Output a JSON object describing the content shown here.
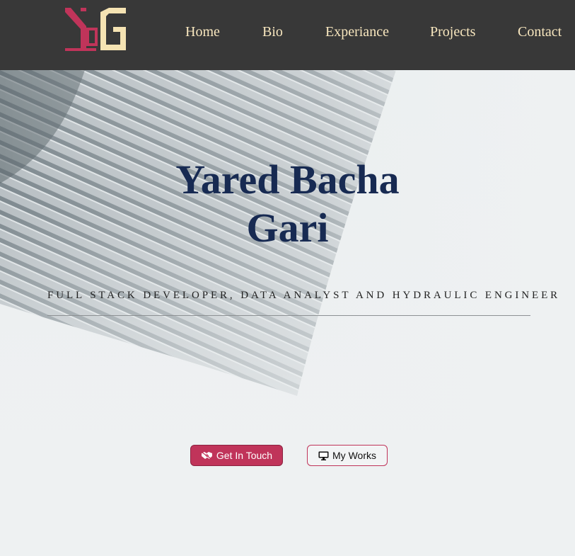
{
  "nav": {
    "logo_text": "YBG",
    "items": [
      {
        "label": "Home"
      },
      {
        "label": "Bio"
      },
      {
        "label": "Experiance"
      },
      {
        "label": "Projects"
      },
      {
        "label": "Contact"
      }
    ]
  },
  "hero": {
    "name_line1": "Yared Bacha",
    "name_line2": "Gari",
    "subtitle": "FULL STACK DEVELOPER, DATA ANALYST AND HYDRAULIC ENGINEER",
    "buttons": {
      "primary": {
        "label": "Get In Touch",
        "icon": "handshake-icon"
      },
      "secondary": {
        "label": "My Works",
        "icon": "desktop-icon"
      }
    }
  },
  "colors": {
    "nav_bg": "#383838",
    "nav_text": "#f7e6be",
    "name": "#172a52",
    "accent": "#c0345a",
    "logo_cream": "#f5e3b3"
  }
}
